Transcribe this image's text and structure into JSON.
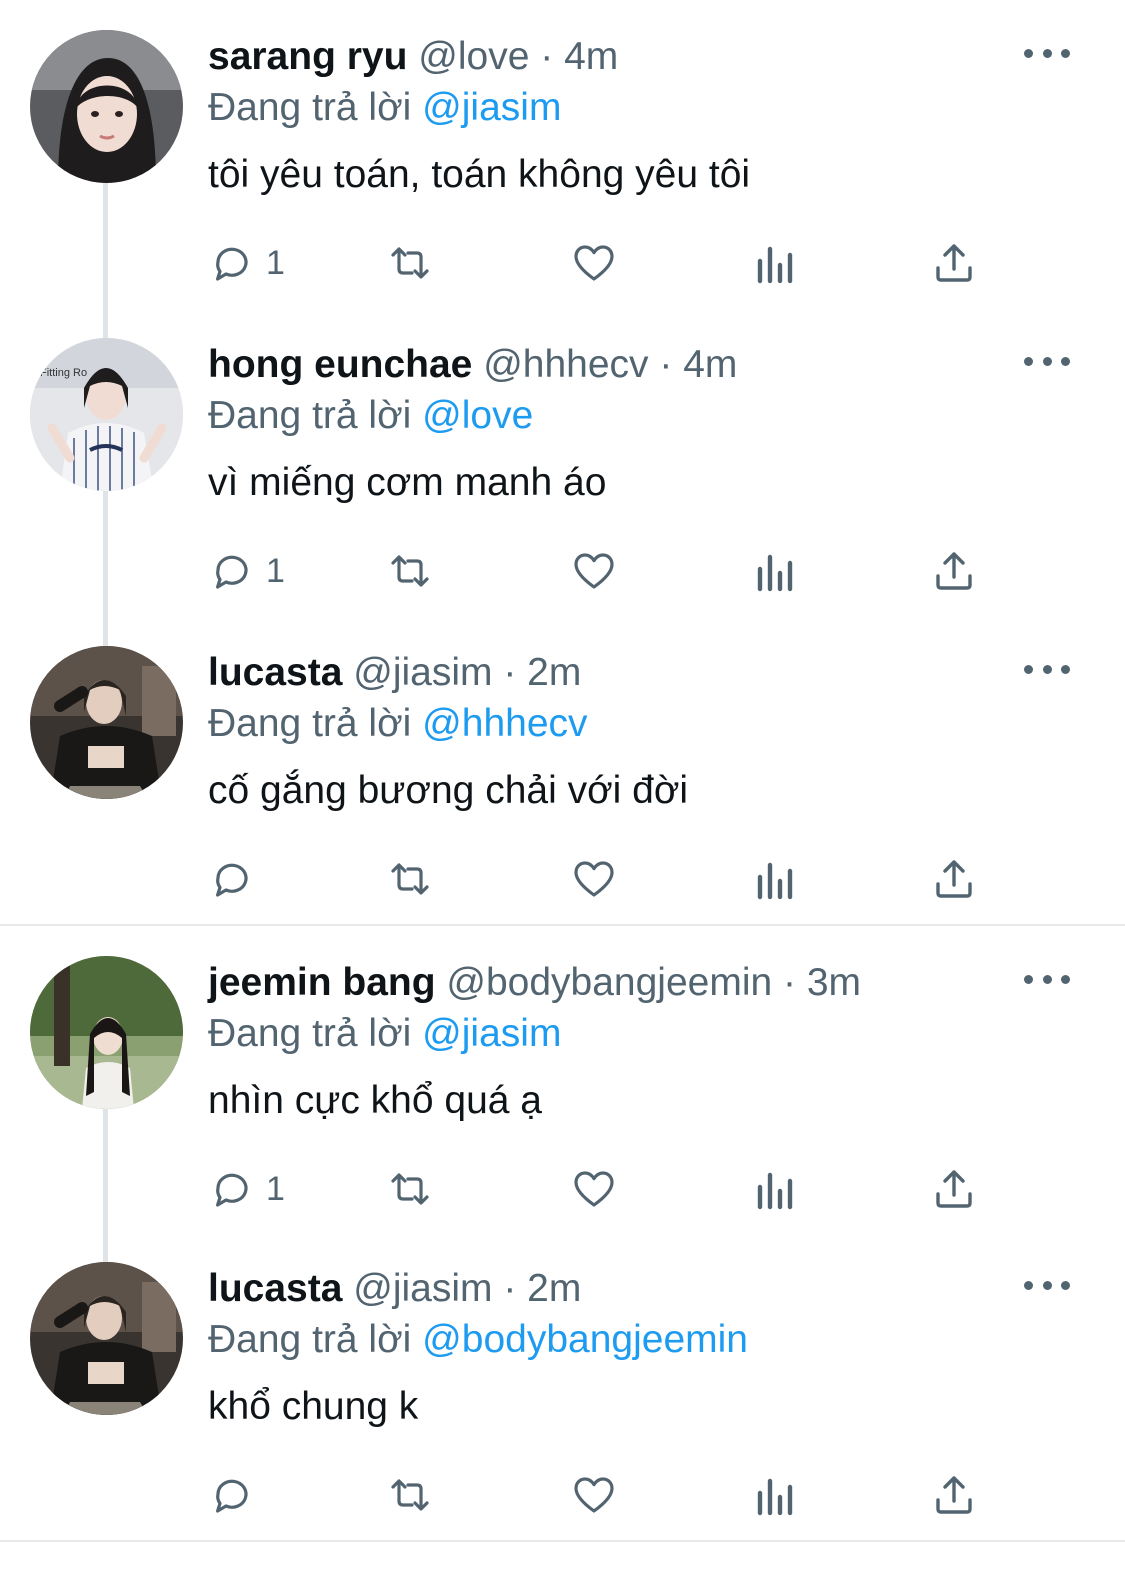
{
  "posts": [
    {
      "display_name": "sarang ryu",
      "handle": "@love",
      "time": "· 4m",
      "reply_prefix": "Đang trả lời",
      "reply_to": "@jiasim",
      "text": "tôi yêu toán, toán không yêu tôi",
      "reply_count": "1",
      "avatar_icon": "profile-photo-icon"
    },
    {
      "display_name": "hong eunchae",
      "handle": "@hhhecv",
      "time": "· 4m",
      "reply_prefix": "Đang trả lời",
      "reply_to": "@love",
      "text": "vì miếng cơm manh áo",
      "reply_count": "1",
      "avatar_icon": "profile-photo-icon"
    },
    {
      "display_name": "lucasta",
      "handle": "@jiasim",
      "time": "· 2m",
      "reply_prefix": "Đang trả lời",
      "reply_to": "@hhhecv",
      "text": "cố gắng bương chải với đời",
      "reply_count": "",
      "avatar_icon": "profile-photo-icon"
    },
    {
      "display_name": "jeemin bang",
      "handle": "@bodybangjeemin",
      "time": "· 3m",
      "reply_prefix": "Đang trả lời",
      "reply_to": "@jiasim",
      "text": "nhìn cực khổ quá ạ",
      "reply_count": "1",
      "avatar_icon": "profile-photo-icon"
    },
    {
      "display_name": "lucasta",
      "handle": "@jiasim",
      "time": "· 2m",
      "reply_prefix": "Đang trả lời",
      "reply_to": "@bodybangjeemin",
      "text": "khổ chung k",
      "reply_count": "",
      "avatar_icon": "profile-photo-icon"
    }
  ],
  "colors": {
    "text_primary": "#0f1419",
    "text_secondary": "#536471",
    "accent": "#1d9bf0",
    "divider": "#e6e8ea",
    "thread_line": "#e1e4e6"
  },
  "action_icons": [
    "reply-icon",
    "retweet-icon",
    "like-icon",
    "views-icon",
    "share-icon"
  ],
  "more_icon": "more-options-icon"
}
